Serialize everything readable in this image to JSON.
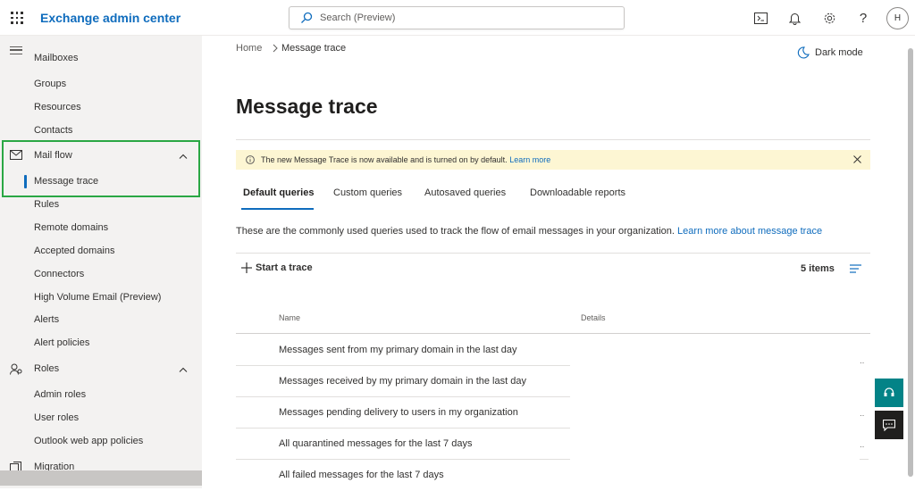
{
  "app": {
    "title": "Exchange admin center"
  },
  "search": {
    "placeholder": "Search (Preview)"
  },
  "topbar": {
    "avatar_initial": "H"
  },
  "sidebar": {
    "cut_item": "Mailboxes",
    "items_top": [
      {
        "label": "Groups"
      },
      {
        "label": "Resources"
      },
      {
        "label": "Contacts"
      }
    ],
    "mailflow": {
      "label": "Mail flow",
      "selected_child": "Message trace"
    },
    "mailflow_children": [
      {
        "label": "Rules"
      },
      {
        "label": "Remote domains"
      },
      {
        "label": "Accepted domains"
      },
      {
        "label": "Connectors"
      },
      {
        "label": "High Volume Email (Preview)"
      },
      {
        "label": "Alerts"
      },
      {
        "label": "Alert policies"
      }
    ],
    "roles": {
      "label": "Roles"
    },
    "roles_children": [
      {
        "label": "Admin roles"
      },
      {
        "label": "User roles"
      },
      {
        "label": "Outlook web app policies"
      }
    ],
    "migration": {
      "label": "Migration"
    }
  },
  "breadcrumb": {
    "home": "Home",
    "current": "Message trace"
  },
  "darkmode": {
    "label": "Dark mode"
  },
  "page": {
    "title": "Message trace"
  },
  "banner": {
    "text": "The new Message Trace is now available and is turned on by default.",
    "link": "Learn more"
  },
  "tabs": [
    {
      "label": "Default queries",
      "active": true
    },
    {
      "label": "Custom queries"
    },
    {
      "label": "Autosaved queries"
    },
    {
      "label": "Downloadable reports"
    }
  ],
  "description": {
    "text": "These are the commonly used queries used to track the flow of email messages in your organization.",
    "link": "Learn more about message trace"
  },
  "toolbar": {
    "start_label": "Start a trace",
    "item_count": "5 items"
  },
  "table": {
    "columns": [
      "Name",
      "Details"
    ],
    "rows": [
      {
        "name": "Messages sent from my primary domain in the last day"
      },
      {
        "name": "Messages received by my primary domain in the last day"
      },
      {
        "name": "Messages pending delivery to users in my organization"
      },
      {
        "name": "All quarantined messages for the last 7 days"
      },
      {
        "name": "All failed messages for the last 7 days"
      }
    ]
  },
  "colors": {
    "accent": "#0f6cbd",
    "highlight": "#2aa744",
    "banner_bg": "#fdf6d3",
    "help_fab": "#038387"
  }
}
